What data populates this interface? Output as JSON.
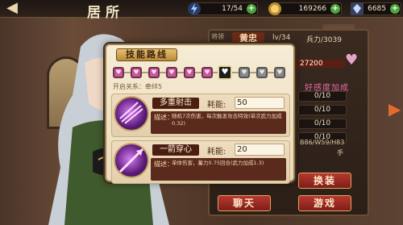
{
  "top_bar": {
    "title": "居所",
    "resources": [
      {
        "icon": "lightning-icon",
        "value": "17/54"
      },
      {
        "icon": "coin-icon",
        "value": "169266"
      },
      {
        "icon": "gem-icon",
        "value": "6685"
      }
    ],
    "plus_label": "+"
  },
  "hero_panel": {
    "name_label": "将领",
    "name": "黄忠",
    "level": "lv/34",
    "force": "兵力/3039",
    "hp": "27200",
    "bonus_title": "好感度加成",
    "stats": [
      "0/10",
      "0/10",
      "0/10",
      "0/10"
    ],
    "skill_ids": "B86/W59/H83",
    "buttons": {
      "swap": "换装",
      "chat": "聊天",
      "game": "游戏"
    },
    "hand_hint": "手"
  },
  "popup": {
    "title": "技能路线",
    "fetter": "开启关系：牵绊5",
    "nodes_unlocked": 6,
    "node_current_index": 6,
    "nodes_total": 10,
    "skills": [
      {
        "name": "多重射击",
        "cost_label": "耗能:",
        "cost": "50",
        "desc_label": "描述：",
        "description": "随机7次伤害，每次触发攻击特效(单次武力加成0.32)"
      },
      {
        "name": "一箭穿心",
        "cost_label": "耗能:",
        "cost": "20",
        "desc_label": "描述：",
        "description": "单体伤害，蓄力0.75回合(武力加成1.3)"
      }
    ]
  },
  "colors": {
    "accent": "#c35b94",
    "button": "#b8382f",
    "panel": "#f6ecd4"
  }
}
